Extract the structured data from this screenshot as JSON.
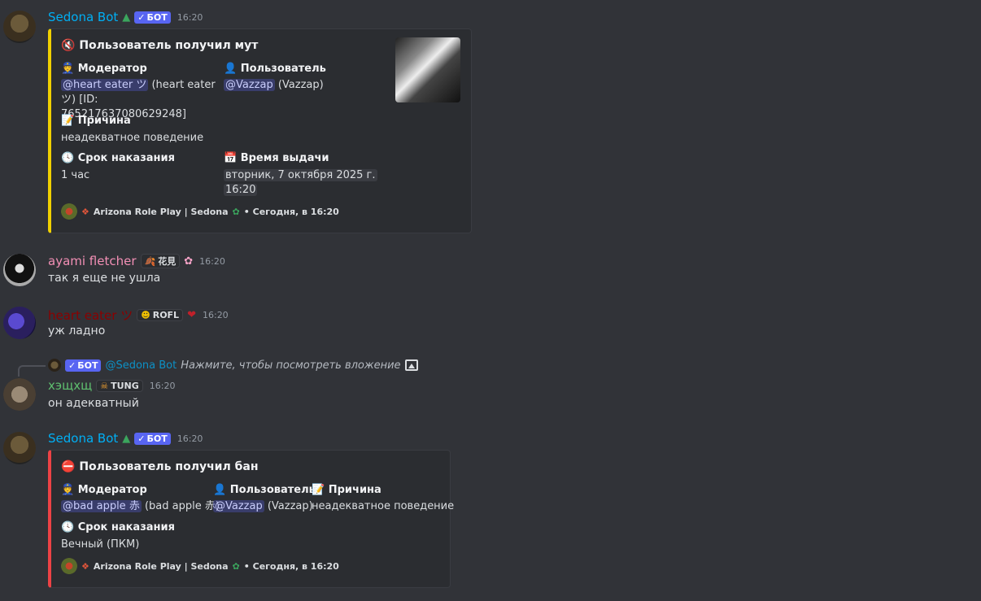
{
  "messages": {
    "m1": {
      "username": "Sedona Bot",
      "username_color": "#00aff4",
      "bot_tag": "БОТ",
      "time": "16:20",
      "embed": {
        "title": "Пользователь получил мут",
        "moderator_label": "Модератор",
        "moderator_mention": "@heart eater ツ",
        "moderator_rest": " (heart eater ツ) [ID: 765217637080629248]",
        "user_label": "Пользователь",
        "user_mention": "@Vazzap",
        "user_rest": " (Vazzap)",
        "reason_label": "Причина",
        "reason_value": "неадекватное поведение",
        "term_label": "Срок наказания",
        "term_value": "1 час",
        "issued_label": "Время выдачи",
        "issued_value_1": "вторник, 7 октября 2025 г.",
        "issued_value_2": "16:20",
        "footer_server": "Arizona Role Play | Sedona",
        "footer_time": "• Сегодня, в 16:20"
      }
    },
    "m2": {
      "username": "ayami fletcher",
      "username_color": "#f28fb5",
      "role": "花見",
      "time": "16:20",
      "text": "так я еще не ушла"
    },
    "m3": {
      "username": "heart eater",
      "username_suffix": "ツ",
      "username_color": "#8b0000",
      "role": "ROFL",
      "time": "16:20",
      "text": "уж ладно"
    },
    "m4": {
      "reply_bot_tag": "БОТ",
      "reply_mention": "@Sedona Bot",
      "reply_text": "Нажмите, чтобы посмотреть вложение",
      "username": "хэщхщ",
      "username_color": "#5fbf6f",
      "role": "TUNG",
      "time": "16:20",
      "text": "он адекватный"
    },
    "m5": {
      "username": "Sedona Bot",
      "bot_tag": "БОТ",
      "time": "16:20",
      "embed": {
        "title": "Пользователь получил бан",
        "moderator_label": "Модератор",
        "moderator_mention": "@bad apple 赤",
        "moderator_rest": " (bad apple 赤)",
        "user_label": "Пользователь",
        "user_mention": "@Vazzap",
        "user_rest": " (Vazzap)",
        "reason_label": "Причина",
        "reason_value": "неадекватное поведение",
        "term_label": "Срок наказания",
        "term_value": "Вечный (ПКМ)",
        "footer_server": "Arizona Role Play | Sedona",
        "footer_time": "• Сегодня, в 16:20"
      }
    }
  }
}
